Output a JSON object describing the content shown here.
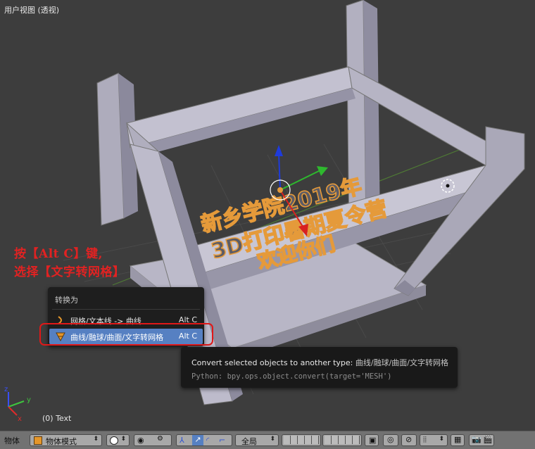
{
  "viewport": {
    "title": "用户视图 (透视)",
    "object_label": "(0) Text"
  },
  "annotation": {
    "line1": "按【Alt C】键,",
    "line2": "选择【文字转网格】"
  },
  "menu": {
    "title": "转换为",
    "items": [
      {
        "label": "网格/文本线 -> 曲线",
        "shortcut": "Alt C",
        "icon": "curve-icon",
        "active": false
      },
      {
        "label": "曲线/融球/曲面/文字转网格",
        "shortcut": "Alt C",
        "icon": "mesh-icon",
        "active": true
      }
    ]
  },
  "tooltip": {
    "description": "Convert selected objects to another type:",
    "highlight": "曲线/融球/曲面/文字转网格",
    "python": "Python: bpy.ops.object.convert(target='MESH')"
  },
  "scene_text": {
    "line1": "新乡学院2019年",
    "line2": "3D打印暑期夏令营",
    "line3": "欢迎你们"
  },
  "header": {
    "object_label": "物体",
    "mode": "物体模式",
    "orientation": "全局"
  },
  "colors": {
    "background": "#3d3d3d",
    "menu_bg": "#1e1e1e",
    "menu_active": "#5680c2",
    "annotation_red": "#e01818",
    "header_bg": "#727272",
    "text_outline": "#e59a3a"
  }
}
